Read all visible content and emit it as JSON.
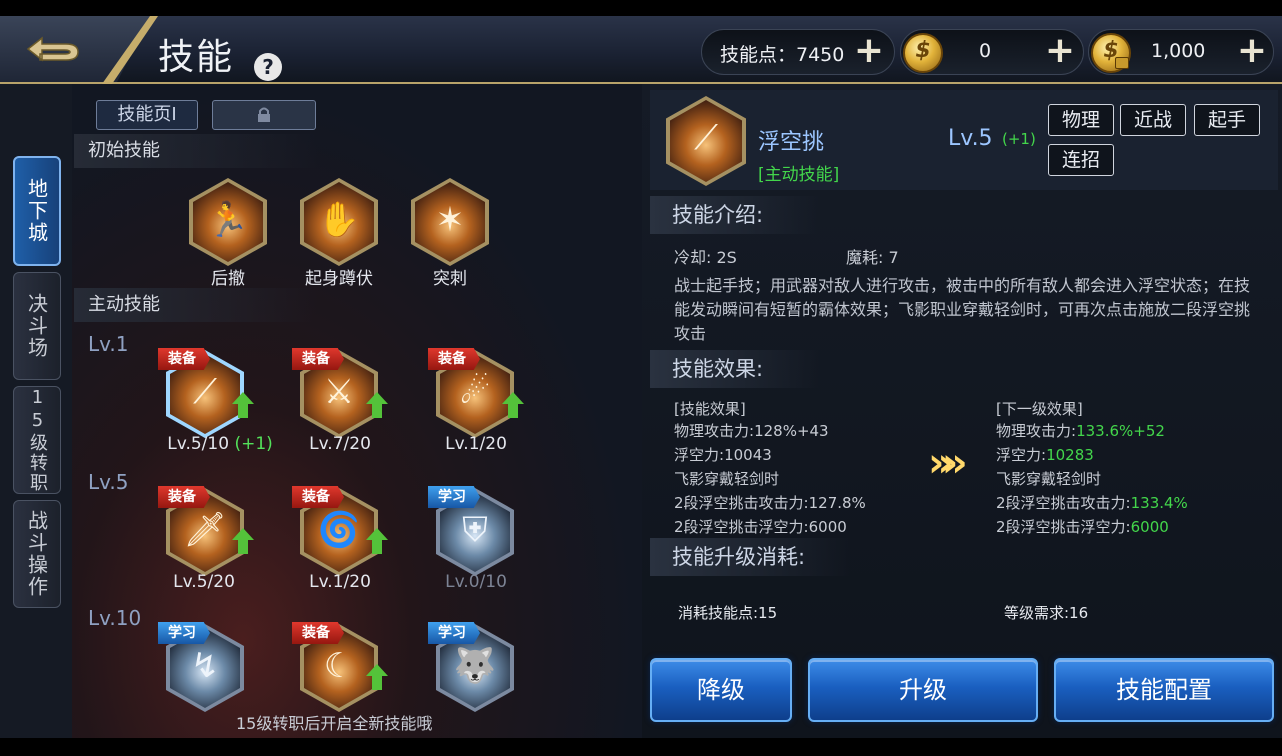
{
  "header": {
    "title": "技能",
    "help_glyph": "?",
    "currencies": [
      {
        "label": "技能点：7450",
        "icon": "plus-icon"
      },
      {
        "label": "0",
        "icon": "gold-coin-icon"
      },
      {
        "label": "1,000",
        "icon": "locked-gold-coin-icon"
      }
    ],
    "plus_glyph": "+"
  },
  "side_tabs": [
    {
      "label": "地下城",
      "active": true
    },
    {
      "label": "决斗场",
      "active": false
    },
    {
      "label": "15级转职",
      "active": false
    },
    {
      "label": "战斗操作",
      "active": false
    }
  ],
  "skill_pages": {
    "page1": "技能页Ⅰ",
    "page2_locked": true
  },
  "tree": {
    "initial_title": "初始技能",
    "initial_skills": [
      {
        "name": "后撤",
        "glyph": "🏃"
      },
      {
        "name": "起身蹲伏",
        "glyph": "✋"
      },
      {
        "name": "突刺",
        "glyph": "✶"
      }
    ],
    "active_title": "主动技能",
    "levels": [
      "Lv.1",
      "Lv.5",
      "Lv.10"
    ],
    "active_skills": [
      {
        "badge": "装备",
        "badge_color": "red",
        "level": "Lv.5/10",
        "plus": "(+1)",
        "upgradable": true,
        "selected": true,
        "glyph": "⟋"
      },
      {
        "badge": "装备",
        "badge_color": "red",
        "level": "Lv.7/20",
        "upgradable": true,
        "glyph": "⚔"
      },
      {
        "badge": "装备",
        "badge_color": "red",
        "level": "Lv.1/20",
        "upgradable": true,
        "glyph": "☄"
      },
      {
        "badge": "装备",
        "badge_color": "red",
        "level": "Lv.5/20",
        "upgradable": true,
        "glyph": "🗡"
      },
      {
        "badge": "装备",
        "badge_color": "red",
        "level": "Lv.1/20",
        "upgradable": true,
        "glyph": "🌀"
      },
      {
        "badge": "学习",
        "badge_color": "blue",
        "level": "Lv.0/10",
        "upgradable": false,
        "dim": true,
        "glyph": "⛨"
      },
      {
        "badge": "学习",
        "badge_color": "blue",
        "level": "",
        "upgradable": false,
        "glyph": "↯"
      },
      {
        "badge": "装备",
        "badge_color": "red",
        "level": "",
        "upgradable": true,
        "glyph": "☾"
      },
      {
        "badge": "学习",
        "badge_color": "blue",
        "level": "",
        "upgradable": false,
        "glyph": "🐺"
      }
    ],
    "footnote": "15级转职后开启全新技能哦"
  },
  "detail": {
    "name": "浮空挑",
    "type": "[主动技能]",
    "level": "Lv.5",
    "level_plus": "(+1)",
    "tags": [
      "物理",
      "近战",
      "起手",
      "连招"
    ],
    "intro_title": "技能介绍:",
    "cooldown": "冷却: 2S",
    "mana": "魔耗: 7",
    "description": "战士起手技；用武器对敌人进行攻击，被击中的所有敌人都会进入浮空状态；在技能发动瞬间有短暂的霸体效果；飞影职业穿戴轻剑时，可再次点击施放二段浮空挑攻击",
    "effect_title": "技能效果:",
    "current": {
      "header": "[技能效果]",
      "rows": [
        {
          "label": "物理攻击力:",
          "value": "128%+43"
        },
        {
          "label": "浮空力:",
          "value": "10043"
        },
        {
          "label": "飞影穿戴轻剑时",
          "value": ""
        },
        {
          "label": "2段浮空挑击攻击力:",
          "value": "127.8%"
        },
        {
          "label": "2段浮空挑击浮空力:",
          "value": "6000"
        }
      ]
    },
    "next": {
      "header": "[下一级效果]",
      "rows": [
        {
          "label": "物理攻击力:",
          "value": "133.6%+52"
        },
        {
          "label": "浮空力:",
          "value": "10283"
        },
        {
          "label": "飞影穿戴轻剑时",
          "value": ""
        },
        {
          "label": "2段浮空挑击攻击力:",
          "value": "133.4%"
        },
        {
          "label": "2段浮空挑击浮空力:",
          "value": "6000"
        }
      ]
    },
    "arrow_glyph": "»",
    "cost_title": "技能升级消耗:",
    "cost_points": "消耗技能点:15",
    "cost_level": "等级需求:16"
  },
  "buttons": {
    "downgrade": "降级",
    "upgrade": "升级",
    "config": "技能配置"
  },
  "colors": {
    "accent_blue": "#1a5fc0",
    "green": "#43d64b",
    "gold": "#b8a36a",
    "equip_red": "#c6281f",
    "learn_blue": "#2a7fd4"
  }
}
